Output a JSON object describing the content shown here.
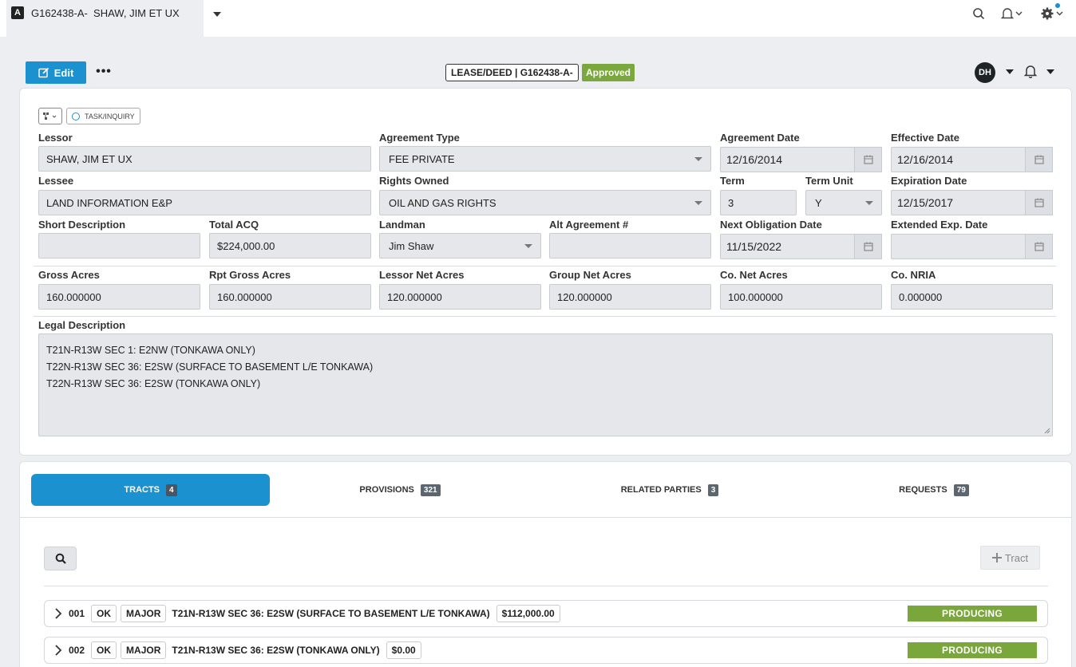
{
  "window": {
    "app_badge": "A",
    "tab_title": "G162438-A-  SHAW, JIM ET UX"
  },
  "toolbar": {
    "edit_label": "Edit",
    "more_label": "•••",
    "doc_tag": "LEASE/DEED | G162438-A-",
    "status": "Approved",
    "user_initials": "DH"
  },
  "form": {
    "task_label": "TASK/INQUIRY",
    "lessor": {
      "label": "Lessor",
      "value": "SHAW, JIM ET UX"
    },
    "agreement_type": {
      "label": "Agreement Type",
      "value": "FEE PRIVATE"
    },
    "agreement_date": {
      "label": "Agreement Date",
      "value": "12/16/2014"
    },
    "effective_date": {
      "label": "Effective Date",
      "value": "12/16/2014"
    },
    "lessee": {
      "label": "Lessee",
      "value": "LAND INFORMATION E&P"
    },
    "rights_owned": {
      "label": "Rights Owned",
      "value": "OIL AND GAS RIGHTS"
    },
    "term": {
      "label": "Term",
      "value": "3"
    },
    "term_unit": {
      "label": "Term Unit",
      "value": "Y"
    },
    "expiration_date": {
      "label": "Expiration Date",
      "value": "12/15/2017"
    },
    "short_description": {
      "label": "Short Description",
      "value": ""
    },
    "total_acq": {
      "label": "Total ACQ",
      "value": "$224,000.00"
    },
    "landman": {
      "label": "Landman",
      "value": "Jim Shaw"
    },
    "alt_agreement": {
      "label": "Alt Agreement #",
      "value": ""
    },
    "next_obligation_date": {
      "label": "Next Obligation Date",
      "value": "11/15/2022"
    },
    "extended_exp_date": {
      "label": "Extended Exp. Date",
      "value": ""
    },
    "gross_acres": {
      "label": "Gross Acres",
      "value": "160.000000"
    },
    "rpt_gross_acres": {
      "label": "Rpt Gross Acres",
      "value": "160.000000"
    },
    "lessor_net_acres": {
      "label": "Lessor Net Acres",
      "value": "120.000000"
    },
    "group_net_acres": {
      "label": "Group Net Acres",
      "value": "120.000000"
    },
    "co_net_acres": {
      "label": "Co. Net Acres",
      "value": "100.000000"
    },
    "co_nria": {
      "label": "Co. NRIA",
      "value": "0.000000"
    },
    "legal_description": {
      "label": "Legal Description",
      "lines": [
        "T21N-R13W SEC 1: E2NW (TONKAWA ONLY)",
        "T22N-R13W SEC 36: E2SW (SURFACE TO BASEMENT L/E TONKAWA)",
        "T22N-R13W SEC 36: E2SW (TONKAWA ONLY)"
      ]
    }
  },
  "tabs": [
    {
      "label": "TRACTS",
      "count": "4"
    },
    {
      "label": "PROVISIONS",
      "count": "321"
    },
    {
      "label": "RELATED PARTIES",
      "count": "3"
    },
    {
      "label": "REQUESTS",
      "count": "79"
    }
  ],
  "tracts_toolbar": {
    "add_label": "Tract"
  },
  "tracts": [
    {
      "num": "001",
      "state": "OK",
      "type": "MAJOR",
      "desc": "T21N-R13W SEC 36: E2SW (SURFACE TO BASEMENT L/E TONKAWA)",
      "amount": "$112,000.00",
      "status": "PRODUCING"
    },
    {
      "num": "002",
      "state": "OK",
      "type": "MAJOR",
      "desc": "T21N-R13W SEC 36: E2SW (TONKAWA ONLY)",
      "amount": "$0.00",
      "status": "PRODUCING"
    }
  ],
  "colors": {
    "accent": "#1b91d0",
    "approved": "#7aa83c",
    "producing": "#79a73b"
  }
}
